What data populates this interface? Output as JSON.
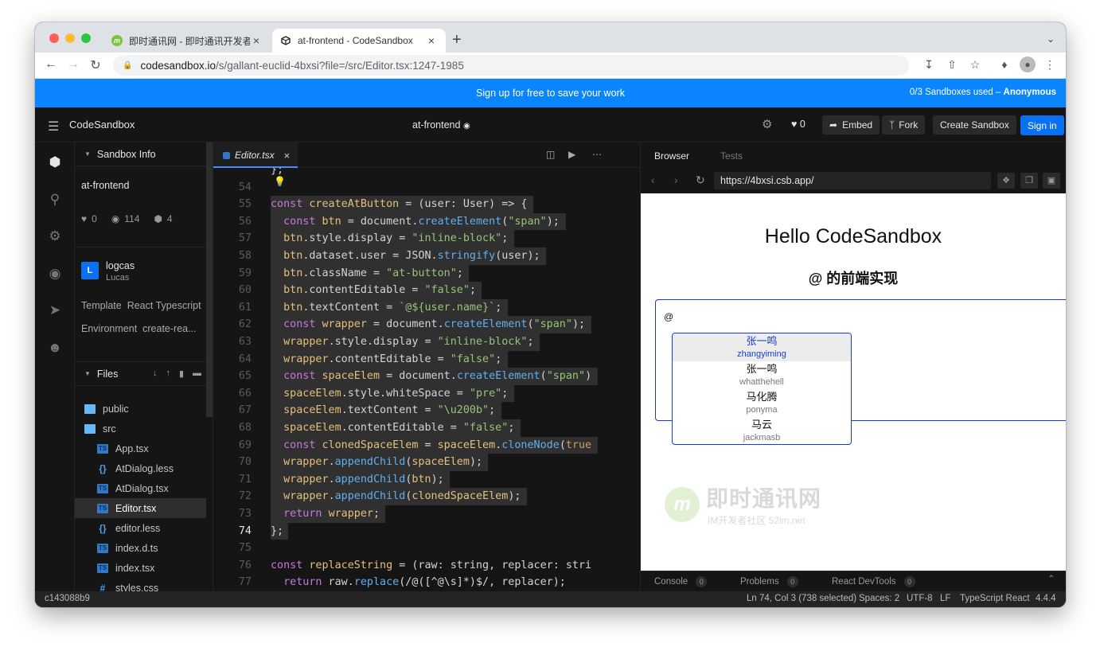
{
  "browser": {
    "tabs": [
      {
        "title": "即时通讯网 - 即时通讯开发者社区",
        "close": "×"
      },
      {
        "title": "at-frontend - CodeSandbox",
        "close": "×"
      }
    ],
    "new_tab": "+",
    "url_host": "codesandbox.io",
    "url_path": "/s/gallant-euclid-4bxsi?file=/src/Editor.tsx:1247-1985"
  },
  "banner": {
    "message": "Sign up for free to save your work",
    "usage": "0/3 Sandboxes used – ",
    "user": "Anonymous"
  },
  "header": {
    "brand": "CodeSandbox",
    "sandbox_name": "at-frontend",
    "likes": "0",
    "embed": "Embed",
    "fork": "Fork",
    "create": "Create Sandbox",
    "signin": "Sign in"
  },
  "sidebar": {
    "section_info": "Sandbox Info",
    "project_name": "at-frontend",
    "stats": {
      "likes": "0",
      "views": "114",
      "forks": "4"
    },
    "author": {
      "initial": "L",
      "username": "logcas",
      "name": "Lucas"
    },
    "template_label": "Template",
    "template_value": "React Typescript",
    "environment_label": "Environment",
    "environment_value": "create-rea...",
    "section_files": "Files",
    "files": [
      {
        "name": "public",
        "type": "folder",
        "depth": 0
      },
      {
        "name": "src",
        "type": "folder-open",
        "depth": 0
      },
      {
        "name": "App.tsx",
        "type": "ts",
        "depth": 1
      },
      {
        "name": "AtDialog.less",
        "type": "style",
        "depth": 1
      },
      {
        "name": "AtDialog.tsx",
        "type": "ts",
        "depth": 1
      },
      {
        "name": "Editor.tsx",
        "type": "ts",
        "depth": 1,
        "selected": true
      },
      {
        "name": "editor.less",
        "type": "style",
        "depth": 1
      },
      {
        "name": "index.d.ts",
        "type": "ts",
        "depth": 1
      },
      {
        "name": "index.tsx",
        "type": "ts",
        "depth": 1
      },
      {
        "name": "styles.css",
        "type": "css",
        "depth": 1
      }
    ]
  },
  "editor": {
    "tab": "Editor.tsx",
    "tab_close": "×",
    "current_line": "74",
    "lines": [
      {
        "n": "",
        "t": "};"
      },
      {
        "n": "54",
        "t": ""
      },
      {
        "n": "55",
        "t": "const createAtButton = (user: User) => {"
      },
      {
        "n": "56",
        "t": "  const btn = document.createElement(\"span\");"
      },
      {
        "n": "57",
        "t": "  btn.style.display = \"inline-block\";"
      },
      {
        "n": "58",
        "t": "  btn.dataset.user = JSON.stringify(user);"
      },
      {
        "n": "59",
        "t": "  btn.className = \"at-button\";"
      },
      {
        "n": "60",
        "t": "  btn.contentEditable = \"false\";"
      },
      {
        "n": "61",
        "t": "  btn.textContent = `@${user.name}`;"
      },
      {
        "n": "62",
        "t": "  const wrapper = document.createElement(\"span\");"
      },
      {
        "n": "63",
        "t": "  wrapper.style.display = \"inline-block\";"
      },
      {
        "n": "64",
        "t": "  wrapper.contentEditable = \"false\";"
      },
      {
        "n": "65",
        "t": "  const spaceElem = document.createElement(\"span\")"
      },
      {
        "n": "66",
        "t": "  spaceElem.style.whiteSpace = \"pre\";"
      },
      {
        "n": "67",
        "t": "  spaceElem.textContent = \"\\u200b\";"
      },
      {
        "n": "68",
        "t": "  spaceElem.contentEditable = \"false\";"
      },
      {
        "n": "69",
        "t": "  const clonedSpaceElem = spaceElem.cloneNode(true"
      },
      {
        "n": "70",
        "t": "  wrapper.appendChild(spaceElem);"
      },
      {
        "n": "71",
        "t": "  wrapper.appendChild(btn);"
      },
      {
        "n": "72",
        "t": "  wrapper.appendChild(clonedSpaceElem);"
      },
      {
        "n": "73",
        "t": "  return wrapper;"
      },
      {
        "n": "74",
        "t": "};"
      },
      {
        "n": "75",
        "t": ""
      },
      {
        "n": "76",
        "t": "const replaceString = (raw: string, replacer: stri"
      },
      {
        "n": "77",
        "t": "  return raw.replace(/@([^@\\s]*)$/, replacer);"
      }
    ]
  },
  "preview": {
    "tab_browser": "Browser",
    "tab_tests": "Tests",
    "url": "https://4bxsi.csb.app/",
    "heading": "Hello CodeSandbox",
    "subheading": "@ 的前端实现",
    "editor_text": "@",
    "mentions": [
      {
        "name": "张一鸣",
        "username": "zhangyiming",
        "highlighted": true
      },
      {
        "name": "张一鸣",
        "username": "whatthehell"
      },
      {
        "name": "马化腾",
        "username": "ponyma"
      },
      {
        "name": "马云",
        "username": "jackmasb"
      }
    ],
    "watermark": {
      "logo": "m",
      "title": "即时通讯网",
      "subtitle": "IM开发者社区 52im.net"
    },
    "console": "Console",
    "console_count": "0",
    "problems": "Problems",
    "problems_count": "0",
    "devtools": "React DevTools",
    "devtools_count": "0"
  },
  "status": {
    "commit": "c143088b9",
    "cursor": "Ln 74, Col 3 (738 selected)",
    "spaces": "Spaces: 2",
    "encoding": "UTF-8",
    "eol": "LF",
    "language": "TypeScript React",
    "version": "4.4.4"
  },
  "colors": {
    "accent": "#0a84ff",
    "signin": "#0971f1",
    "mention_border": "#1a3dc9"
  }
}
